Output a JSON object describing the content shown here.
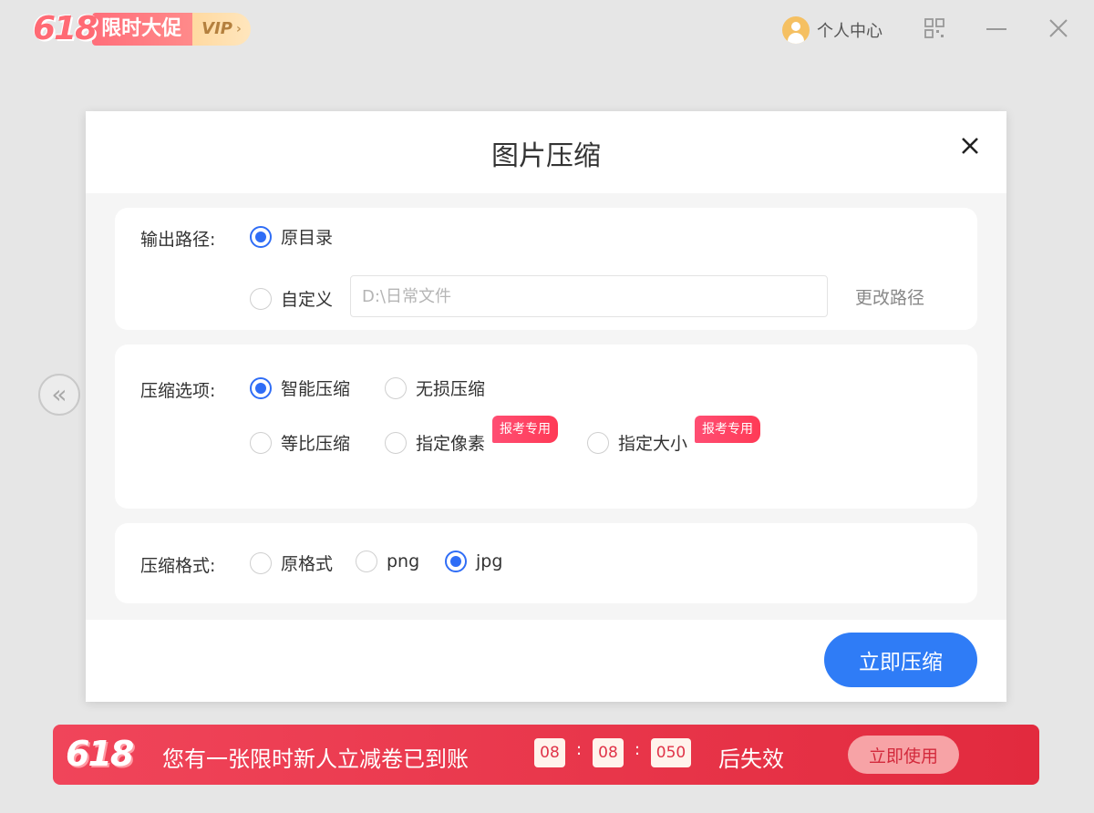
{
  "topbar": {
    "promo_logo": "618",
    "promo_label": "限时大促",
    "vip_label": "VIP",
    "vip_chevron": "›",
    "user_center_label": "个人中心"
  },
  "side_arrow": "«",
  "dialog": {
    "title": "图片压缩",
    "output": {
      "label": "输出路径:",
      "options": [
        {
          "label": "原目录",
          "checked": true
        },
        {
          "label": "自定义",
          "checked": false
        }
      ],
      "path_placeholder": "D:\\日常文件",
      "change_path_label": "更改路径"
    },
    "compress_options": {
      "label": "压缩选项:",
      "options": [
        {
          "label": "智能压缩",
          "checked": true
        },
        {
          "label": "无损压缩",
          "checked": false
        },
        {
          "label": "等比压缩",
          "checked": false
        },
        {
          "label": "指定像素",
          "checked": false,
          "tag": "报考专用"
        },
        {
          "label": "指定大小",
          "checked": false,
          "tag": "报考专用"
        }
      ]
    },
    "format": {
      "label": "压缩格式:",
      "options": [
        {
          "label": "原格式",
          "checked": false
        },
        {
          "label": "png",
          "checked": false
        },
        {
          "label": "jpg",
          "checked": true
        }
      ]
    },
    "submit_label": "立即压缩"
  },
  "banner": {
    "logo": "618",
    "message": "您有一张限时新人立减卷已到账",
    "countdown": [
      "08",
      "08",
      "050"
    ],
    "separator": ":",
    "suffix": "后失效",
    "button_label": "立即使用"
  },
  "colors": {
    "accent": "#2f7cf6",
    "radio_checked": "#2f6df6",
    "banner_red": "#e22a3e",
    "tag_pink": "#ff4e73"
  },
  "icons": {
    "avatar": "avatar-icon",
    "grid": "grid-icon",
    "minimize": "minimize-icon",
    "close_window": "close-icon",
    "dialog_close": "close-icon",
    "side_arrow": "double-chevron-left-icon"
  }
}
